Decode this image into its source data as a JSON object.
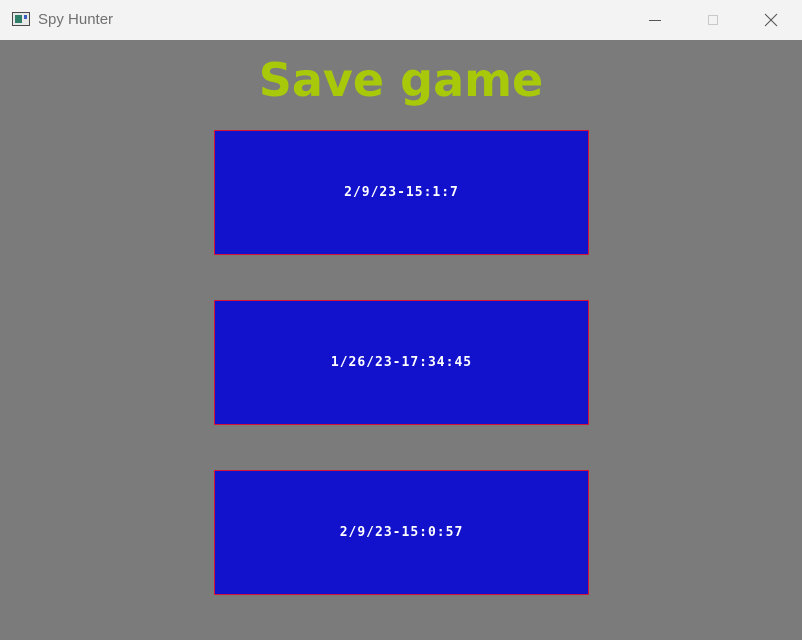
{
  "window": {
    "title": "Spy Hunter",
    "icon": "app-window-icon",
    "controls": {
      "minimize_icon": "minimize-icon",
      "maximize_icon": "maximize-icon",
      "close_icon": "close-icon"
    }
  },
  "screen": {
    "heading": "Save game",
    "save_slots": [
      {
        "label": "2/9/23-15:1:7"
      },
      {
        "label": "1/26/23-17:34:45"
      },
      {
        "label": "2/9/23-15:0:57"
      }
    ]
  },
  "colors": {
    "background": "#7b7b7b",
    "heading": "#a8c80a",
    "slot_fill": "#1212cc",
    "slot_border": "#d2143a",
    "slot_text": "#ffffff"
  }
}
